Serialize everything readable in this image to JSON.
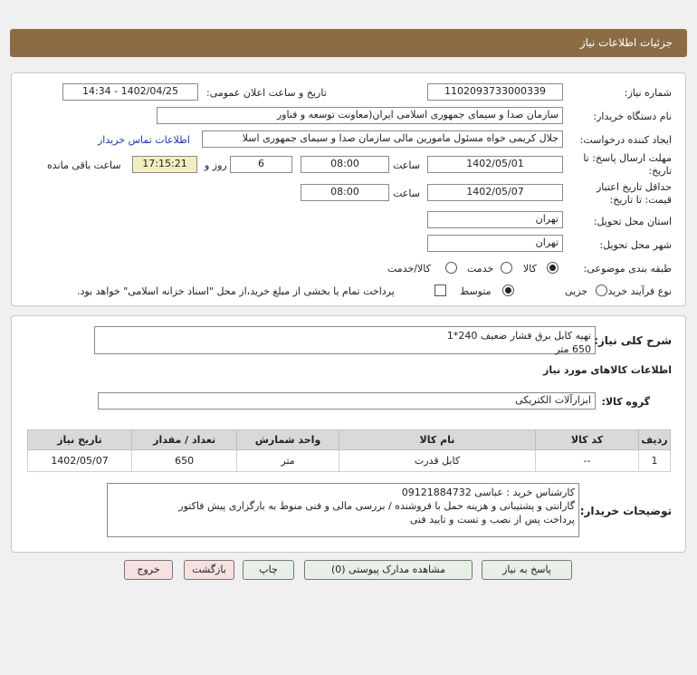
{
  "header": {
    "title": "جزئیات اطلاعات نیاز"
  },
  "form": {
    "need_number_label": "شماره نیاز:",
    "need_number": "1102093733000339",
    "announce_label": "تاریخ و ساعت اعلان عمومی:",
    "announce_value": "1402/04/25 - 14:34",
    "buyer_org_label": "نام دستگاه خریدار:",
    "buyer_org": "سازمان صدا و سیمای جمهوری اسلامی ایران(معاونت توسعه و فناور",
    "creator_label": "ایجاد کننده درخواست:",
    "creator": "جلال کریمی خواه مسئول مامورین مالی  سازمان صدا و سیمای جمهوری اسلا",
    "contact_link": "اطلاعات تماس خریدار",
    "reply_deadline_label_1": "مهلت ارسال پاسخ: تا",
    "reply_deadline_label_2": "تاریخ:",
    "reply_date": "1402/05/01",
    "time_label": "ساعت",
    "reply_time": "08:00",
    "days": "6",
    "days_label": "روز و",
    "remaining_time": "17:15:21",
    "remaining_label": "ساعت باقی مانده",
    "price_validity_label_1": "حداقل تاریخ اعتبار",
    "price_validity_label_2": "قیمت: تا تاریخ:",
    "validity_date": "1402/05/07",
    "validity_time": "08:00",
    "province_label": "استان محل تحویل:",
    "province": "تهران",
    "city_label": "شهر محل تحویل:",
    "city": "تهران",
    "category_label": "طبقه بندی موضوعی:",
    "category_options": [
      "کالا",
      "خدمت",
      "کالا/خدمت"
    ],
    "process_label": "نوع فرآیند خرید :",
    "process_options": [
      "جزیی",
      "متوسط"
    ],
    "payment_note": "پرداخت تمام یا بخشی از مبلغ خرید،از محل \"اسناد خزانه اسلامی\" خواهد بود."
  },
  "summary": {
    "label": "شرح کلی نیاز:",
    "line1": "تهیه کابل برق فشار ضعیف 240*1",
    "line2": "650 متر",
    "items_title": "اطلاعات کالاهای مورد نیاز",
    "group_label": "گروه کالا:",
    "group_value": "ابزارآلات الکتریکی"
  },
  "table": {
    "headers": [
      "ردیف",
      "کد کالا",
      "نام کالا",
      "واحد شمارش",
      "تعداد / مقدار",
      "تاریخ نیاز"
    ],
    "rows": [
      [
        "1",
        "--",
        "کابل قدرت",
        "متر",
        "650",
        "1402/05/07"
      ]
    ]
  },
  "buyer_notes": {
    "label": "توضیحات خریدار:",
    "line1": "کارشناس خرید : عباسی 09121884732",
    "line2": "گارانتی و پشتیبانی و هزینه حمل با فروشنده / بررسی مالی و فنی منوط به بارگزاری پیش فاکتور",
    "line3": "پرداخت پس از نصب و تست و تایید فنی"
  },
  "buttons": {
    "reply": "پاسخ به نیاز",
    "attachments": "مشاهده مدارک پیوستی (0)",
    "print": "چاپ",
    "back": "بازگشت",
    "exit": "خروج"
  }
}
